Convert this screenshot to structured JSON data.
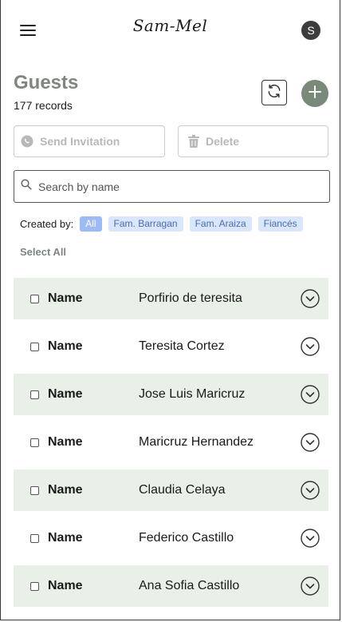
{
  "app": {
    "brand": "Sam-Mel",
    "avatar_initial": "S"
  },
  "page": {
    "title": "Guests",
    "record_count": "177 records"
  },
  "actions": {
    "send_invitation": "Send Invitation",
    "delete": "Delete"
  },
  "search": {
    "placeholder": "Search by name",
    "value": ""
  },
  "filters": {
    "label": "Created by:",
    "chips": [
      "All",
      "Fam. Barragan",
      "Fam. Araiza",
      "Fiancés"
    ],
    "active": "All",
    "select_all": "Select All"
  },
  "guests": [
    {
      "key": "Name",
      "value": "Porfirio de teresita"
    },
    {
      "key": "Name",
      "value": "Teresita Cortez"
    },
    {
      "key": "Name",
      "value": "Jose Luis Maricruz"
    },
    {
      "key": "Name",
      "value": "Maricruz Hernandez"
    },
    {
      "key": "Name",
      "value": "Claudia Celaya"
    },
    {
      "key": "Name",
      "value": "Federico Castillo"
    },
    {
      "key": "Name",
      "value": "Ana Sofia Castillo"
    }
  ],
  "colors": {
    "accent": "#7a8a7a",
    "row_shade": "#e9f0e8",
    "chip_bg": "#d9e6fb",
    "chip_active_bg": "#9cbaf4",
    "title_gray": "#7e8680"
  },
  "icons": {
    "menu": "hamburger-icon",
    "refresh": "refresh-icon",
    "add": "plus-icon",
    "send": "whatsapp-icon",
    "delete": "trash-icon",
    "search": "search-icon",
    "expand": "chevron-down-circle-icon"
  }
}
